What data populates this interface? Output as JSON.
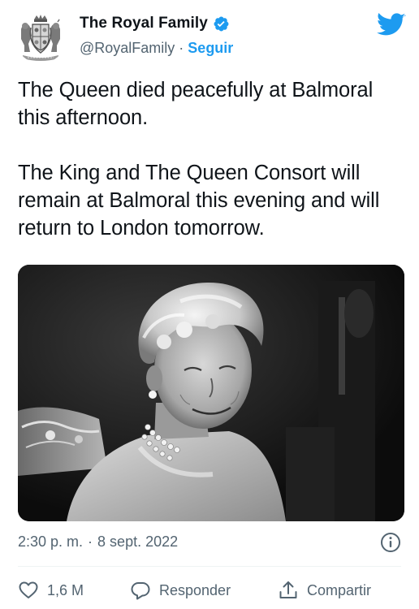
{
  "author": {
    "display_name": "The Royal Family",
    "handle": "@RoyalFamily",
    "separator": "·",
    "follow_label": "Seguir",
    "verified": true,
    "avatar_icon": "royal-coat-of-arms-icon",
    "brand_icon": "twitter-bird-icon"
  },
  "tweet": {
    "paragraphs": [
      "The Queen died peacefully at Balmoral this afternoon.",
      "The King and The Queen Consort will remain at Balmoral this evening and will return to London tomorrow."
    ]
  },
  "media": {
    "type": "photo",
    "tone": "black-and-white"
  },
  "meta": {
    "time": "2:30 p. m.",
    "separator": "·",
    "date": "8 sept. 2022",
    "info_icon": "info-icon"
  },
  "actions": {
    "like_count": "1,6 M",
    "reply_label": "Responder",
    "share_label": "Compartir"
  },
  "colors": {
    "accent": "#1d9bf0",
    "text": "#0f1419",
    "secondary": "#536471",
    "divider": "#eff3f4"
  }
}
